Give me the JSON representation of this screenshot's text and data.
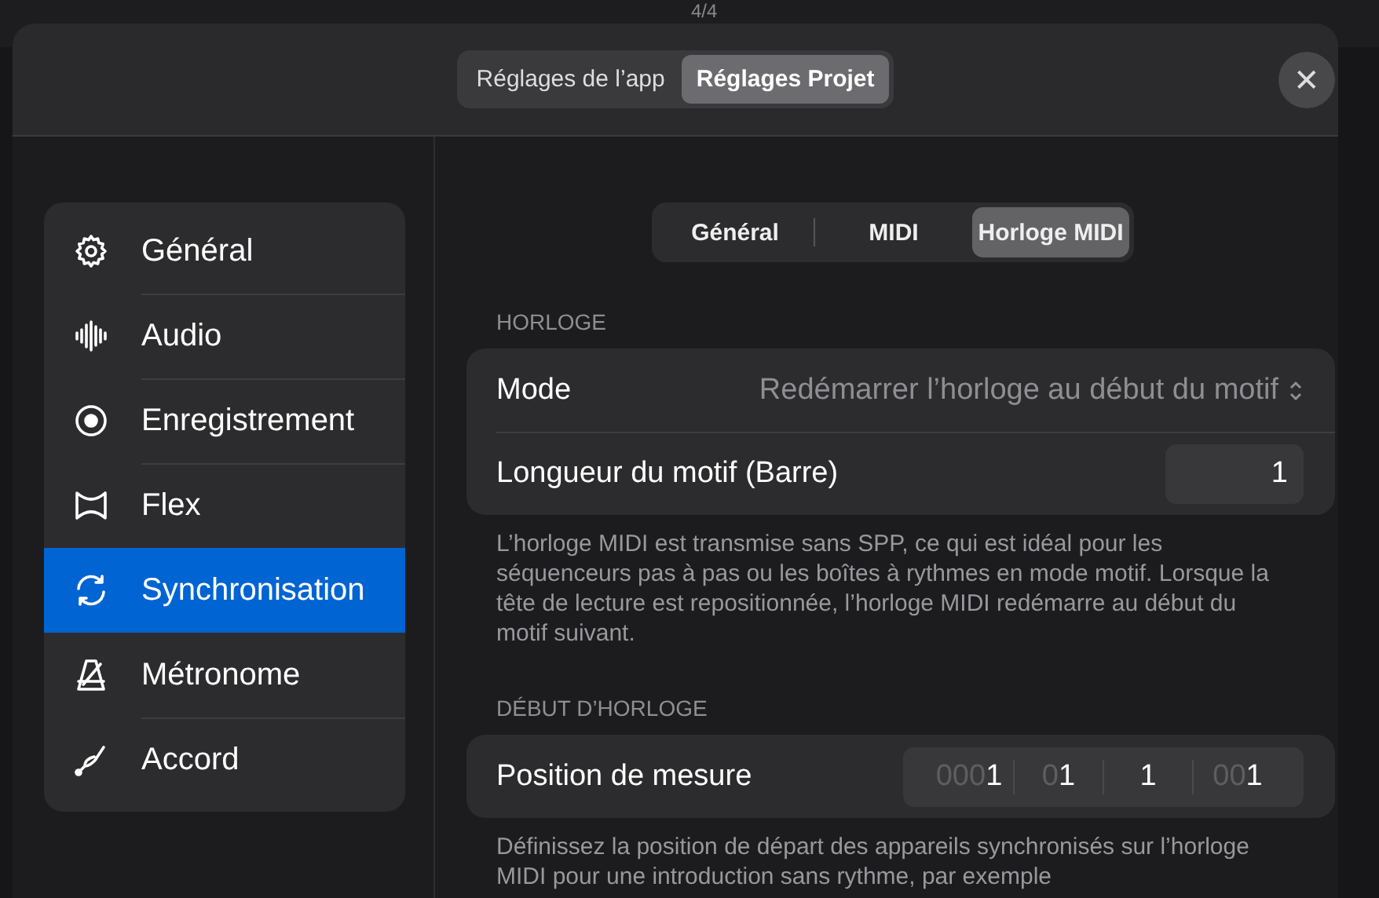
{
  "background_toolbar": {
    "meter": "4/4"
  },
  "header_tabs": [
    {
      "label": "Réglages de l’app",
      "selected": false
    },
    {
      "label": "Réglages Projet",
      "selected": true
    }
  ],
  "close_button": {
    "label": "✕"
  },
  "sidebar": {
    "items": [
      {
        "label": "Général",
        "selected": false
      },
      {
        "label": "Audio",
        "selected": false
      },
      {
        "label": "Enregistrement",
        "selected": false
      },
      {
        "label": "Flex",
        "selected": false
      },
      {
        "label": "Synchronisation",
        "selected": true
      },
      {
        "label": "Métronome",
        "selected": false
      },
      {
        "label": "Accord",
        "selected": false
      }
    ]
  },
  "sub_tabs": [
    {
      "label": "Général",
      "selected": false
    },
    {
      "label": "MIDI",
      "selected": false
    },
    {
      "label": "Horloge MIDI",
      "selected": true
    }
  ],
  "sections": [
    {
      "header": "HORLOGE",
      "rows": [
        {
          "kind": "popup",
          "label": "Mode",
          "value": "Redémarrer l’horloge au début du motif"
        },
        {
          "kind": "number",
          "label": "Longueur du motif (Barre)",
          "value": "1"
        }
      ],
      "footer": "L’horloge MIDI est transmise sans SPP, ce qui est idéal pour les séquenceurs pas à pas ou les boîtes à rythmes en mode motif. Lorsque la tête de lecture est repositionnée, l’horloge MIDI redémarre au début du motif suivant."
    },
    {
      "header": "DÉBUT D’HORLOGE",
      "rows": [
        {
          "kind": "position",
          "label": "Position de mesure",
          "parts": [
            {
              "dim": "000",
              "value": "1"
            },
            {
              "dim": "0",
              "value": "1"
            },
            {
              "value": "1"
            },
            {
              "dim": "00",
              "value": "1"
            }
          ]
        }
      ],
      "footer": "Définissez la position de départ des appareils synchronisés sur l’horloge MIDI pour une introduction sans rythme, par exemple"
    }
  ]
}
